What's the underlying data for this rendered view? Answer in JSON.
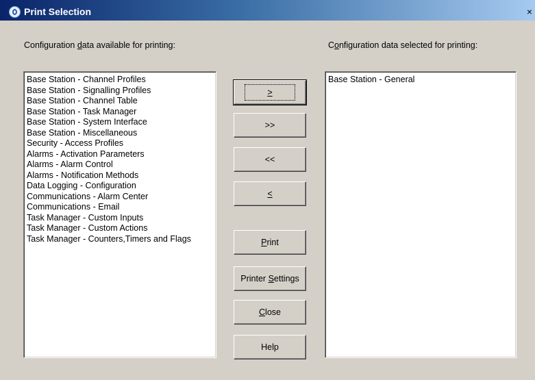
{
  "window": {
    "title": "Print Selection",
    "close_glyph": "×",
    "icon": "app-logo-icon"
  },
  "available": {
    "label_pre": "Configuration ",
    "label_key": "d",
    "label_post": "ata available for printing:",
    "items": [
      "Base Station - Channel Profiles",
      "Base Station - Signalling Profiles",
      "Base Station - Channel Table",
      "Base Station - Task Manager",
      "Base Station - System Interface",
      "Base Station - Miscellaneous",
      "Security - Access Profiles",
      "Alarms - Activation Parameters",
      "Alarms - Alarm Control",
      "Alarms - Notification Methods",
      "Data Logging - Configuration",
      "Communications - Alarm Center",
      "Communications - Email",
      "Task Manager - Custom Inputs",
      "Task Manager - Custom Actions",
      "Task Manager - Counters,Timers and Flags"
    ]
  },
  "selected": {
    "label_pre": "C",
    "label_key": "o",
    "label_post": "nfiguration data selected for printing:",
    "items": [
      "Base Station - General"
    ]
  },
  "buttons": {
    "add_one": ">",
    "add_all": ">>",
    "remove_all": "<<",
    "remove_one": "<",
    "print_key": "P",
    "print_rest": "rint",
    "printer_settings_pre": "Printer ",
    "printer_settings_key": "S",
    "printer_settings_post": "ettings",
    "close_key": "C",
    "close_rest": "lose",
    "help": "Help"
  }
}
